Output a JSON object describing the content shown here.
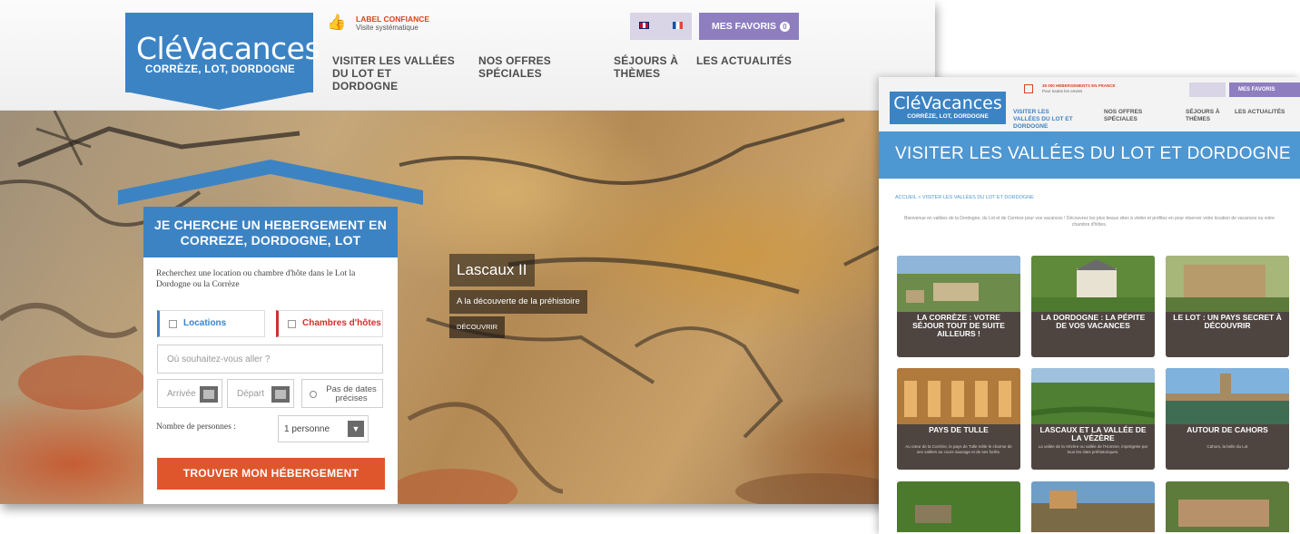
{
  "main_site": {
    "logo": {
      "brand": "CléVacances",
      "tagline": "CORRÈZE, LOT, DORDOGNE"
    },
    "label_badge": {
      "title": "LABEL CONFIANCE",
      "subtitle": "Visite systématique"
    },
    "favorites": {
      "label": "MES FAVORIS",
      "count": "0"
    },
    "nav": [
      {
        "label": "VISITER LES VALLÉES DU LOT ET DORDOGNE"
      },
      {
        "label": "NOS OFFRES SPÉCIALES"
      },
      {
        "label": "SÉJOURS À THÈMES"
      },
      {
        "label": "LES ACTUALITÉS"
      }
    ],
    "search": {
      "heading": "JE CHERCHE UN HEBERGEMENT EN CORREZE, DORDOGNE, LOT",
      "description": "Recherchez une location ou chambre d'hôte dans le Lot la Dordogne ou la Corrèze",
      "option_locations": "Locations",
      "option_chambres": "Chambres d'hôtes",
      "where_placeholder": "Où souhaitez-vous aller ?",
      "arrival_placeholder": "Arrivée",
      "departure_placeholder": "Départ",
      "no_dates": "Pas de dates précises",
      "persons_label": "Nombre de personnes :",
      "persons_value": "1 personne",
      "submit": "TROUVER MON HÉBERGEMENT"
    },
    "slide": {
      "title": "Lascaux II",
      "subtitle": "A la découverte de la préhistoire",
      "button": "DÉCOUVRIR"
    }
  },
  "second_site": {
    "logo": {
      "brand": "CléVacances",
      "tagline": "CORRÈZE, LOT, DORDOGNE"
    },
    "label_badge": {
      "title": "35 000 HÉBERGEMENTS EN FRANCE",
      "subtitle": "Pour toutes les envies"
    },
    "favorites": {
      "label": "MES FAVORIS"
    },
    "nav": [
      {
        "label": "VISITER LES VALLÉES DU LOT ET DORDOGNE"
      },
      {
        "label": "NOS OFFRES SPÉCIALES"
      },
      {
        "label": "SÉJOURS À THÈMES"
      },
      {
        "label": "LES ACTUALITÉS"
      }
    ],
    "page_title": "VISITER LES VALLÉES DU LOT ET DORDOGNE",
    "breadcrumb": "ACCUEIL > VISITER LES VALLÉES DU LOT ET DORDOGNE",
    "intro": "Bienvenue en vallées de la Dordogne, du Lot et de Corrèze pour vos vacances ! Découvrez les plus beaux sites à visiter et profitez en pour réserver votre location de vacances ou votre chambre d'hôtes.",
    "cards": [
      {
        "title": "LA CORRÈZE : VOTRE SÉJOUR TOUT DE SUITE AILLEURS !",
        "desc": ""
      },
      {
        "title": "LA DORDOGNE : LA PÉPITE DE VOS VACANCES",
        "desc": ""
      },
      {
        "title": "LE LOT : UN PAYS SECRET À DÉCOUVRIR",
        "desc": ""
      },
      {
        "title": "PAYS DE TULLE",
        "desc": "Au cœur de la Corrèze, le pays de Tulle mêle le charme de ses vallées au cours sauvage et de ses forêts."
      },
      {
        "title": "LASCAUX ET LA VALLÉE DE LA VÉZÈRE",
        "desc": "La vallée de la Vézère ou vallée de l'Homme, imprégnée par tous les sites préhistoriques."
      },
      {
        "title": "AUTOUR DE CAHORS",
        "desc": "Cahors, la belle du Lot"
      }
    ]
  },
  "colors": {
    "brand_blue": "#3c83c4",
    "accent_orange": "#e0562c",
    "favorites_purple": "#8e7ec0",
    "card_brown": "#4e4541"
  }
}
